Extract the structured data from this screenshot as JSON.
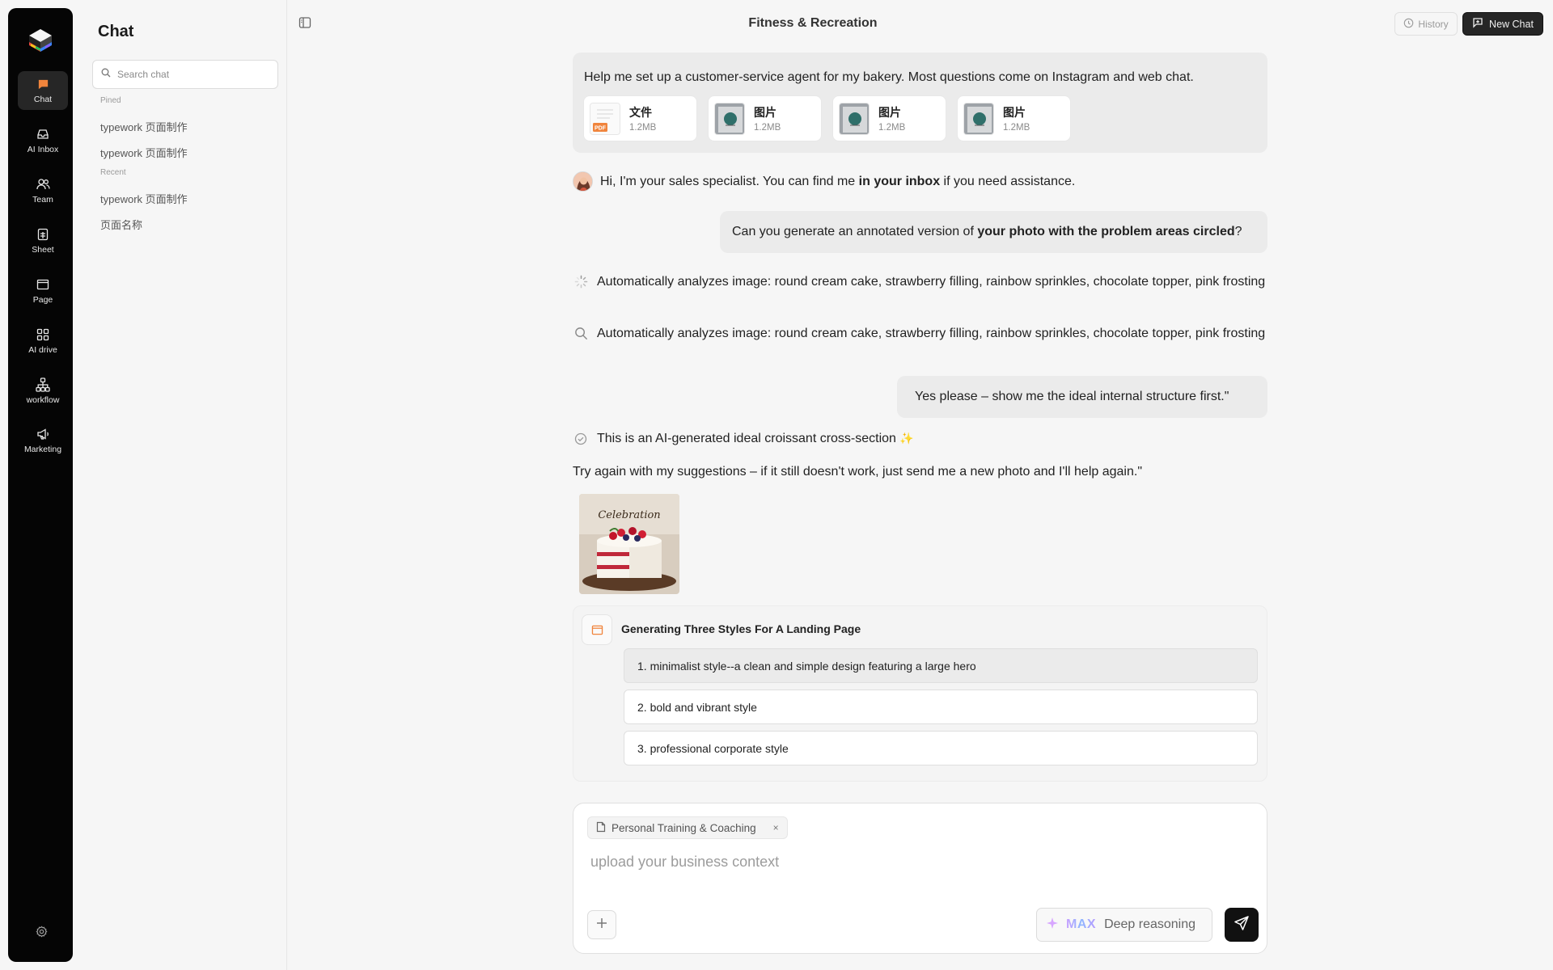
{
  "rail": {
    "items": [
      {
        "label": "Chat",
        "icon": "chat-icon"
      },
      {
        "label": "AI Inbox",
        "icon": "inbox-icon"
      },
      {
        "label": "Team",
        "icon": "team-icon"
      },
      {
        "label": "Sheet",
        "icon": "sheet-icon"
      },
      {
        "label": "Page",
        "icon": "page-icon"
      },
      {
        "label": "AI drive",
        "icon": "drive-icon"
      },
      {
        "label": "workflow",
        "icon": "workflow-icon"
      },
      {
        "label": "Marketing",
        "icon": "megaphone-icon"
      }
    ],
    "active": "Chat",
    "accent": "#f0843c"
  },
  "sidebar": {
    "title": "Chat",
    "search_placeholder": "Search chat",
    "pinned_label": "Pined",
    "pinned": [
      "typework 页面制作",
      "typework 页面制作"
    ],
    "recent_label": "Recent",
    "recent": [
      "typework 页面制作",
      "页面名称"
    ]
  },
  "header": {
    "title": "Fitness & Recreation",
    "history_label": "History",
    "new_chat_label": "New Chat"
  },
  "messages": {
    "first_user": "Help me set up a customer-service agent for my bakery. Most questions come on Instagram and web chat.",
    "attachments": [
      {
        "name": "文件",
        "size": "1.2MB",
        "type": "pdf"
      },
      {
        "name": "图片",
        "size": "1.2MB",
        "type": "image"
      },
      {
        "name": "图片",
        "size": "1.2MB",
        "type": "image"
      },
      {
        "name": "图片",
        "size": "1.2MB",
        "type": "image"
      }
    ],
    "agent_intro_a": "Hi, I'm your sales specialist. You can find me ",
    "agent_intro_b": "in your inbox",
    "agent_intro_c": " if you need assistance.",
    "user_q_a": "Can you generate an annotated version of ",
    "user_q_b": "your photo with the problem areas circled",
    "user_q_c": "?",
    "analyze_1": "Automatically analyzes image: round cream cake, strawberry filling, rainbow sprinkles, chocolate topper, pink frosting",
    "analyze_2": "Automatically analyzes image: round cream cake, strawberry filling, rainbow sprinkles, chocolate topper, pink frosting",
    "user_yes": "Yes please – show me the ideal internal structure first.\"",
    "ai_generated": "This is an AI-generated ideal croissant cross-section",
    "sparkle": "✨",
    "try_again": "Try again with my suggestions – if it still doesn't work, just send me a new photo and I'll help again.\"",
    "cake_caption": "Celebration"
  },
  "generation": {
    "title": "Generating Three Styles For A Landing Page",
    "options": [
      "1. minimalist style--a clean and simple design featuring a large hero",
      "2. bold and vibrant style",
      "3. professional corporate style"
    ],
    "selected_index": 0
  },
  "composer": {
    "chip_label": "Personal Training & Coaching",
    "chip_close": "×",
    "placeholder": "upload your business context",
    "max_label": "MAX",
    "reasoning_label": "Deep reasoning"
  }
}
